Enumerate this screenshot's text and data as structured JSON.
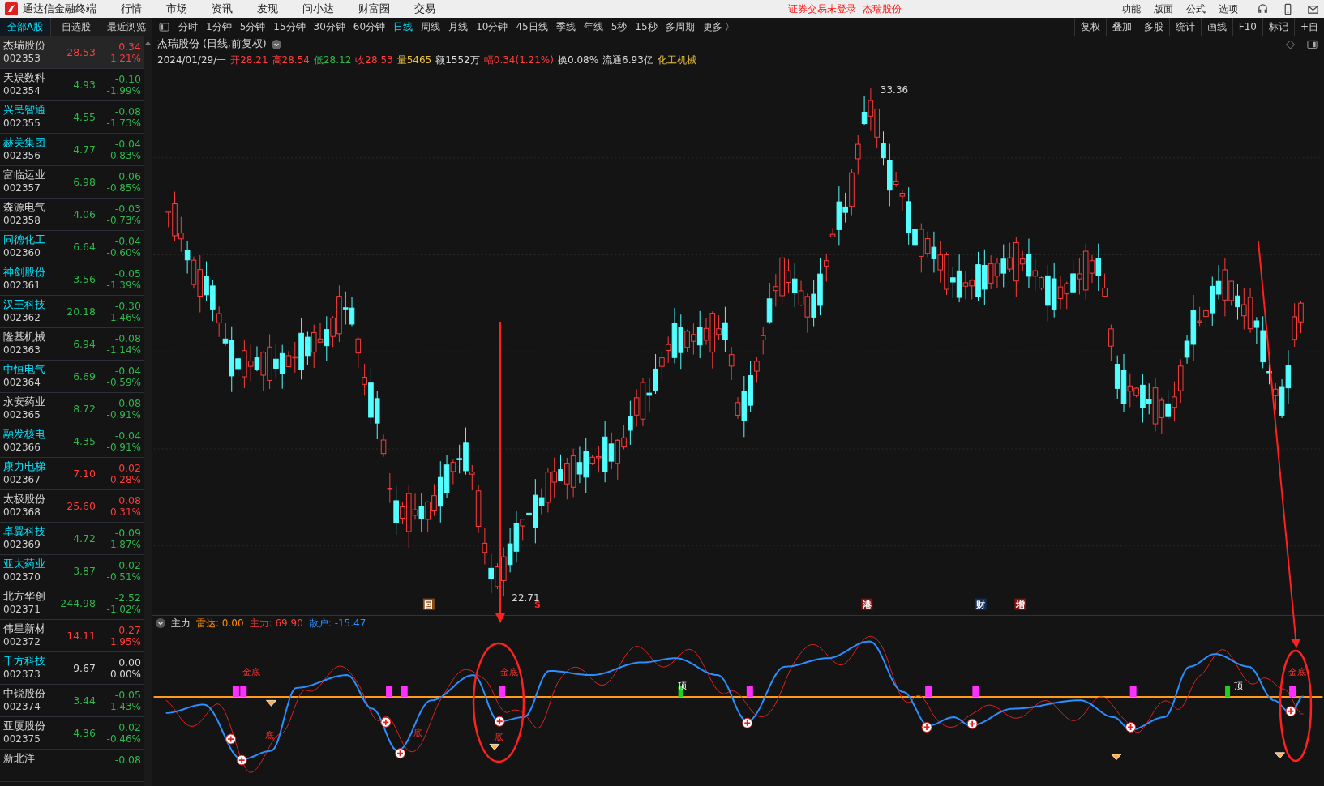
{
  "app": {
    "title": "通达信金融终端"
  },
  "menu": [
    "行情",
    "市场",
    "资讯",
    "发现",
    "问小达",
    "财富圈",
    "交易"
  ],
  "notice": {
    "login": "证券交易未登录",
    "stock": "杰瑞股份"
  },
  "right_menu": [
    "功能",
    "版面",
    "公式",
    "选项"
  ],
  "list_tabs": [
    {
      "label": "全部A股",
      "selected": true
    },
    {
      "label": "自选股",
      "selected": false
    },
    {
      "label": "最近浏览",
      "selected": false
    }
  ],
  "periods": [
    {
      "label": "分时",
      "selected": false
    },
    {
      "label": "1分钟",
      "selected": false
    },
    {
      "label": "5分钟",
      "selected": false
    },
    {
      "label": "15分钟",
      "selected": false
    },
    {
      "label": "30分钟",
      "selected": false
    },
    {
      "label": "60分钟",
      "selected": false
    },
    {
      "label": "日线",
      "selected": true
    },
    {
      "label": "周线",
      "selected": false
    },
    {
      "label": "月线",
      "selected": false
    },
    {
      "label": "10分钟",
      "selected": false
    },
    {
      "label": "45日线",
      "selected": false
    },
    {
      "label": "季线",
      "selected": false
    },
    {
      "label": "年线",
      "selected": false
    },
    {
      "label": "5秒",
      "selected": false
    },
    {
      "label": "15秒",
      "selected": false
    },
    {
      "label": "多周期",
      "selected": false
    },
    {
      "label": "更多 〉",
      "selected": false
    }
  ],
  "tools": [
    "复权",
    "叠加",
    "多股",
    "统计",
    "画线",
    "F10",
    "标记",
    "+自"
  ],
  "stocks": [
    {
      "name": "杰瑞股份",
      "code": "002353",
      "price": "28.53",
      "change": "0.34",
      "pct": "1.21%",
      "color": "#ff3b3b",
      "marked": false,
      "selected": true
    },
    {
      "name": "天娱数科",
      "code": "002354",
      "price": "4.93",
      "change": "-0.10",
      "pct": "-1.99%",
      "color": "#2fb64c",
      "marked": false,
      "selected": false
    },
    {
      "name": "兴民智通",
      "code": "002355",
      "price": "4.55",
      "change": "-0.08",
      "pct": "-1.73%",
      "color": "#2fb64c",
      "marked": true,
      "selected": false
    },
    {
      "name": "赫美集团",
      "code": "002356",
      "price": "4.77",
      "change": "-0.04",
      "pct": "-0.83%",
      "color": "#2fb64c",
      "marked": true,
      "selected": false
    },
    {
      "name": "富临运业",
      "code": "002357",
      "price": "6.98",
      "change": "-0.06",
      "pct": "-0.85%",
      "color": "#2fb64c",
      "marked": false,
      "selected": false
    },
    {
      "name": "森源电气",
      "code": "002358",
      "price": "4.06",
      "change": "-0.03",
      "pct": "-0.73%",
      "color": "#2fb64c",
      "marked": false,
      "selected": false
    },
    {
      "name": "同德化工",
      "code": "002360",
      "price": "6.64",
      "change": "-0.04",
      "pct": "-0.60%",
      "color": "#2fb64c",
      "marked": true,
      "selected": false
    },
    {
      "name": "神剑股份",
      "code": "002361",
      "price": "3.56",
      "change": "-0.05",
      "pct": "-1.39%",
      "color": "#2fb64c",
      "marked": true,
      "selected": false
    },
    {
      "name": "汉王科技",
      "code": "002362",
      "price": "20.18",
      "change": "-0.30",
      "pct": "-1.46%",
      "color": "#2fb64c",
      "marked": true,
      "selected": false
    },
    {
      "name": "隆基机械",
      "code": "002363",
      "price": "6.94",
      "change": "-0.08",
      "pct": "-1.14%",
      "color": "#2fb64c",
      "marked": false,
      "selected": false
    },
    {
      "name": "中恒电气",
      "code": "002364",
      "price": "6.69",
      "change": "-0.04",
      "pct": "-0.59%",
      "color": "#2fb64c",
      "marked": true,
      "selected": false
    },
    {
      "name": "永安药业",
      "code": "002365",
      "price": "8.72",
      "change": "-0.08",
      "pct": "-0.91%",
      "color": "#2fb64c",
      "marked": false,
      "selected": false
    },
    {
      "name": "融发核电",
      "code": "002366",
      "price": "4.35",
      "change": "-0.04",
      "pct": "-0.91%",
      "color": "#2fb64c",
      "marked": true,
      "selected": false
    },
    {
      "name": "康力电梯",
      "code": "002367",
      "price": "7.10",
      "change": "0.02",
      "pct": "0.28%",
      "color": "#ff3b3b",
      "marked": true,
      "selected": false
    },
    {
      "name": "太极股份",
      "code": "002368",
      "price": "25.60",
      "change": "0.08",
      "pct": "0.31%",
      "color": "#ff3b3b",
      "marked": false,
      "selected": false
    },
    {
      "name": "卓翼科技",
      "code": "002369",
      "price": "4.72",
      "change": "-0.09",
      "pct": "-1.87%",
      "color": "#2fb64c",
      "marked": true,
      "selected": false
    },
    {
      "name": "亚太药业",
      "code": "002370",
      "price": "3.87",
      "change": "-0.02",
      "pct": "-0.51%",
      "color": "#2fb64c",
      "marked": true,
      "selected": false
    },
    {
      "name": "北方华创",
      "code": "002371",
      "price": "244.98",
      "change": "-2.52",
      "pct": "-1.02%",
      "color": "#2fb64c",
      "marked": false,
      "selected": false
    },
    {
      "name": "伟星新材",
      "code": "002372",
      "price": "14.11",
      "change": "0.27",
      "pct": "1.95%",
      "color": "#ff3b3b",
      "marked": false,
      "selected": false
    },
    {
      "name": "千方科技",
      "code": "002373",
      "price": "9.67",
      "change": "0.00",
      "pct": "0.00%",
      "color": "#d8d8d8",
      "marked": true,
      "selected": false
    },
    {
      "name": "中锐股份",
      "code": "002374",
      "price": "3.44",
      "change": "-0.05",
      "pct": "-1.43%",
      "color": "#2fb64c",
      "marked": false,
      "selected": false
    },
    {
      "name": "亚厦股份",
      "code": "002375",
      "price": "4.36",
      "change": "-0.02",
      "pct": "-0.46%",
      "color": "#2fb64c",
      "marked": false,
      "selected": false
    },
    {
      "name": "新北洋",
      "change": "-0.08",
      "color": "#2fb64c",
      "marked": false,
      "selected": false
    }
  ],
  "chart": {
    "title": "杰瑞股份 (日线,前复权)",
    "quote": [
      {
        "text": "2024/01/29/一",
        "color": "#d8d8d8"
      },
      {
        "text": "开28.21",
        "color": "#ff3b3b"
      },
      {
        "text": "高28.54",
        "color": "#ff3b3b"
      },
      {
        "text": "低28.12",
        "color": "#2fb64c"
      },
      {
        "text": "收28.53",
        "color": "#ff3b3b"
      },
      {
        "text": "量5465",
        "color": "#e8c040"
      },
      {
        "text": "额1552万",
        "color": "#d8d8d8"
      },
      {
        "text": "幅0.34(1.21%)",
        "color": "#ff3b3b"
      },
      {
        "text": "换0.08%",
        "color": "#d8d8d8"
      },
      {
        "text": "流通6.93亿",
        "color": "#d8d8d8"
      },
      {
        "text": "化工机械",
        "color": "#e8c040"
      }
    ],
    "high_label": "33.36",
    "low_label": "22.71",
    "events": [
      {
        "text": "回",
        "kind": "tag",
        "color": "#8a4a14"
      },
      {
        "text": "S",
        "kind": "text",
        "color": "#ff2020"
      },
      {
        "text": "港",
        "kind": "tag",
        "color": "#8a1010"
      },
      {
        "text": "财",
        "kind": "tag",
        "color": "#12305e"
      },
      {
        "text": "增",
        "kind": "tag",
        "color": "#8a1010"
      }
    ]
  },
  "indicator": {
    "name": "主力",
    "values": [
      {
        "text": "雷达: 0.00",
        "color": "#ff8a00"
      },
      {
        "text": "主力: 69.90",
        "color": "#ff3b3b"
      },
      {
        "text": "散户: -15.47",
        "color": "#2b8fff"
      }
    ],
    "signals": [
      {
        "text": "金底",
        "kind": "gold"
      },
      {
        "text": "金底",
        "kind": "gold"
      },
      {
        "text": "金底",
        "kind": "gold"
      },
      {
        "text": "底",
        "kind": "bottom"
      },
      {
        "text": "底",
        "kind": "bottom"
      },
      {
        "text": "底",
        "kind": "bottom"
      },
      {
        "text": "顶",
        "kind": "top"
      },
      {
        "text": "顶",
        "kind": "top"
      }
    ]
  }
}
